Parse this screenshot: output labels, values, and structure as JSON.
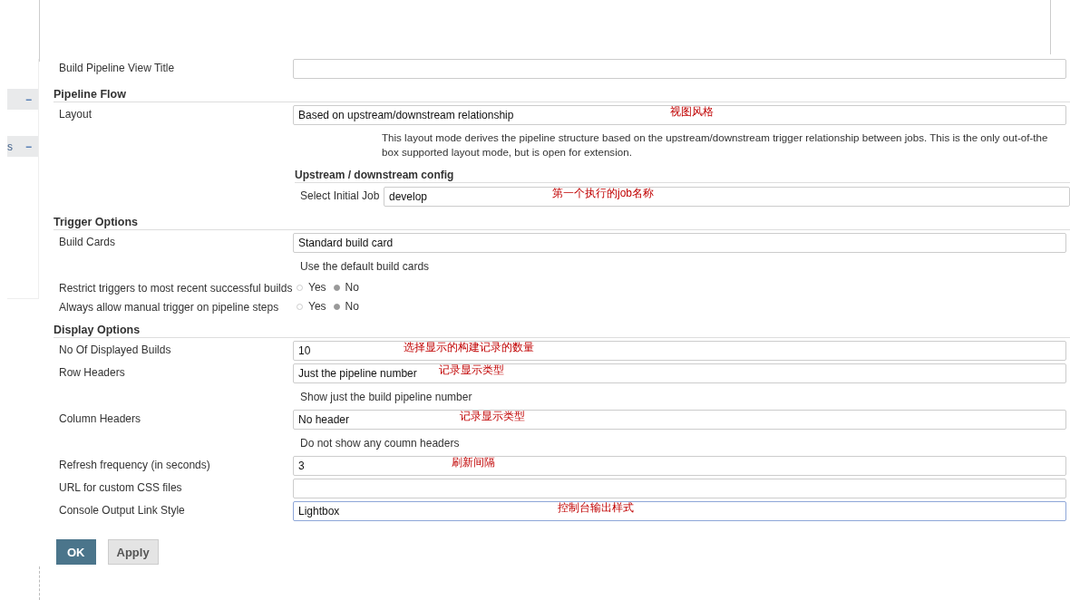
{
  "sidebar": {
    "items": [
      {
        "collapse_icon": "−"
      },
      {
        "label": "s",
        "collapse_icon": "−"
      }
    ]
  },
  "form": {
    "rows": [
      {
        "kind": "text",
        "label": "Build Pipeline View Title"
      },
      {
        "kind": "section",
        "label": "Pipeline Flow"
      },
      {
        "kind": "select",
        "label": "Layout",
        "value": "Based on upstream/downstream relationship",
        "note": "视图风格",
        "help_lines": [
          "This layout mode derives the pipeline structure based on the upstream/downstream trigger relationship between jobs. This is the only out-of-the",
          "box supported layout mode, but is open for extension."
        ]
      },
      {
        "kind": "subsection",
        "label": "Upstream / downstream config",
        "field_label": "Select Initial Job",
        "value": "develop",
        "note": "第一个执行的job名称"
      },
      {
        "kind": "section",
        "label": "Trigger Options"
      },
      {
        "kind": "select",
        "label": "Build Cards",
        "value": "Standard build card",
        "help_lines": [
          "Use the default build cards"
        ]
      },
      {
        "kind": "radio",
        "label": "Restrict triggers to most recent successful builds",
        "options": [
          {
            "label": "Yes",
            "selected": false
          },
          {
            "label": "No",
            "selected": true
          }
        ]
      },
      {
        "kind": "radio",
        "label": "Always allow manual trigger on pipeline steps",
        "options": [
          {
            "label": "Yes",
            "selected": false
          },
          {
            "label": "No",
            "selected": true
          }
        ]
      },
      {
        "kind": "section",
        "label": "Display Options"
      },
      {
        "kind": "text",
        "label": "No Of Displayed Builds",
        "value": "10",
        "note": "选择显示的构建记录的数量"
      },
      {
        "kind": "select",
        "label": "Row Headers",
        "value": "Just the pipeline number",
        "note": "记录显示类型",
        "help_lines": [
          "Show just the build pipeline number"
        ]
      },
      {
        "kind": "select",
        "label": "Column Headers",
        "value": "No header",
        "note": "记录显示类型",
        "help_lines": [
          "Do not show any coumn headers"
        ]
      },
      {
        "kind": "text",
        "label": "Refresh frequency (in seconds)",
        "value": "3",
        "note": "刷新间隔"
      },
      {
        "kind": "text",
        "label": "URL for custom CSS files"
      },
      {
        "kind": "select",
        "label": "Console Output Link Style",
        "value": "Lightbox",
        "note": "控制台输出样式",
        "focused": true
      }
    ]
  },
  "buttons": [
    {
      "label": "OK",
      "kind": "primary"
    },
    {
      "label": "Apply",
      "kind": "secondary"
    }
  ]
}
